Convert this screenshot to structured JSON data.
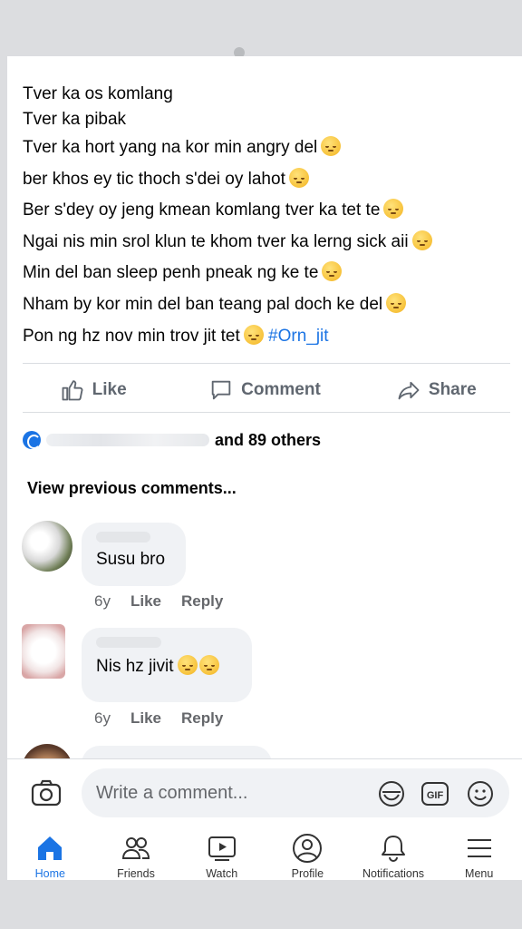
{
  "post": {
    "lines": [
      "Tver ka os komlang",
      "Tver ka pibak",
      "Tver ka hort yang na kor min angry del",
      "ber khos ey tic thoch s'dei oy lahot",
      "Ber s'dey oy jeng kmean komlang tver ka tet te",
      "Ngai nis min srol klun te khom tver ka lerng sick aii",
      "Min del ban sleep penh pneak ng ke te",
      "Nham by kor min del ban teang pal doch ke del",
      "Pon ng hz nov min trov jit tet"
    ],
    "hashtag": "#Orn_jit"
  },
  "actions": {
    "like": "Like",
    "comment": "Comment",
    "share": "Share"
  },
  "reactions": {
    "others": "and 89 others"
  },
  "comments": {
    "view_previous": "View previous comments...",
    "items": [
      {
        "text": "Susu bro",
        "time": "6y",
        "like": "Like",
        "reply": "Reply"
      },
      {
        "text": "Nis hz jivit",
        "time": "6y",
        "like": "Like",
        "reply": "Reply"
      }
    ]
  },
  "compose": {
    "placeholder": "Write a comment..."
  },
  "tabs": [
    {
      "label": "Home",
      "icon": "home-icon",
      "active": true
    },
    {
      "label": "Friends",
      "icon": "friends-icon"
    },
    {
      "label": "Watch",
      "icon": "watch-icon"
    },
    {
      "label": "Profile",
      "icon": "profile-icon"
    },
    {
      "label": "Notifications",
      "icon": "bell-icon"
    },
    {
      "label": "Menu",
      "icon": "menu-icon"
    }
  ],
  "colors": {
    "accent": "#1b74e4",
    "bubble": "#f0f2f5"
  }
}
